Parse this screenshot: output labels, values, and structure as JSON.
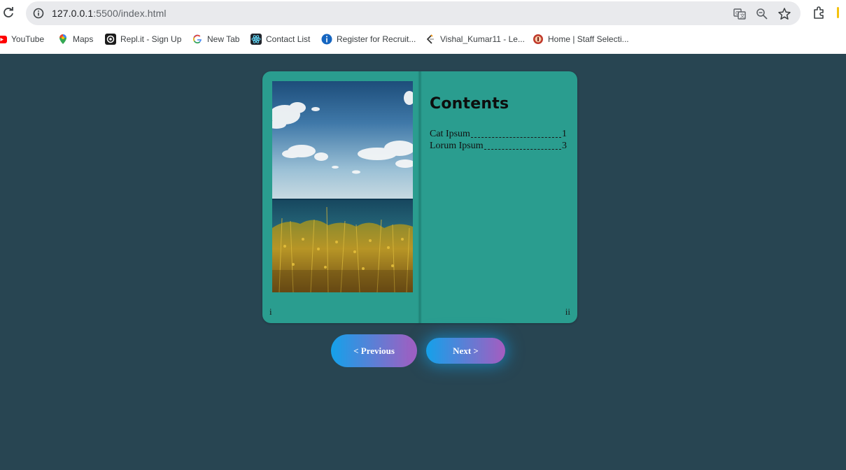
{
  "browser": {
    "url_host": "127.0.0.1",
    "url_rest": ":5500/index.html",
    "icons": [
      "reload-icon",
      "site-info-icon",
      "translate-icon",
      "zoom-icon",
      "bookmark-star-icon",
      "extensions-icon"
    ]
  },
  "bookmarks": [
    {
      "label": "YouTube",
      "icon": "youtube-icon"
    },
    {
      "label": "Maps",
      "icon": "maps-icon"
    },
    {
      "label": "Repl.it - Sign Up",
      "icon": "replit-icon"
    },
    {
      "label": "New Tab",
      "icon": "google-icon"
    },
    {
      "label": "Contact List",
      "icon": "react-icon"
    },
    {
      "label": "Register for Recruit...",
      "icon": "info-icon"
    },
    {
      "label": "Vishal_Kumar11 - Le...",
      "icon": "leetcode-icon"
    },
    {
      "label": "Home | Staff Selecti...",
      "icon": "emblem-icon"
    }
  ],
  "book": {
    "left_page": {
      "number": "i",
      "image": "landscape-sea-grass-photo"
    },
    "right_page": {
      "number": "ii",
      "title": "Contents",
      "toc": [
        {
          "label": "Cat Ipsum",
          "page": "1"
        },
        {
          "label": "Lorum Ipsum",
          "page": "3"
        }
      ]
    }
  },
  "buttons": {
    "previous": "< Previous",
    "next": "Next >"
  },
  "colors": {
    "background": "#284552",
    "book": "#2a9d8f",
    "button_gradient_start": "#14a1ea",
    "button_gradient_end": "#a55cc0"
  }
}
